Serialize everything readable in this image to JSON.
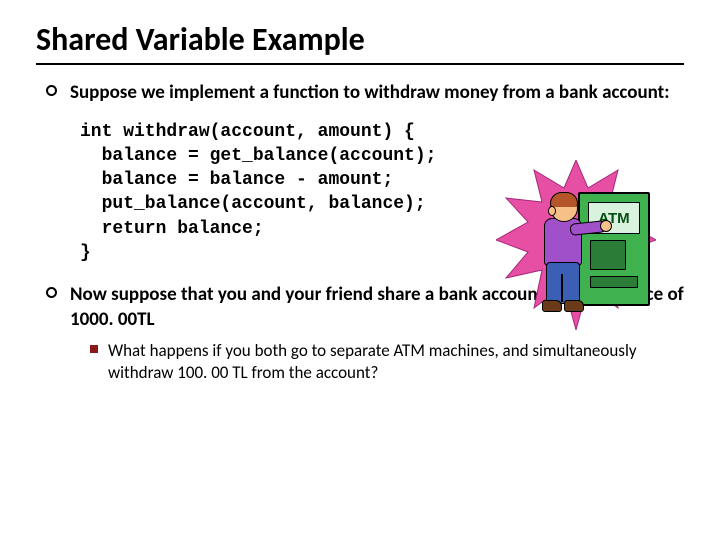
{
  "title": "Shared Variable Example",
  "bullets": {
    "b1": "Suppose we implement a function to withdraw money from a bank account:",
    "b2": "Now suppose that you and your friend share a bank account with a balance of 1000. 00TL",
    "sub1": "What happens if you both go to separate ATM machines, and simultaneously withdraw 100. 00 TL from the account?"
  },
  "code": "int withdraw(account, amount) {\n  balance = get_balance(account);\n  balance = balance - amount;\n  put_balance(account, balance);\n  return balance;\n}",
  "atm_label": "ATM"
}
